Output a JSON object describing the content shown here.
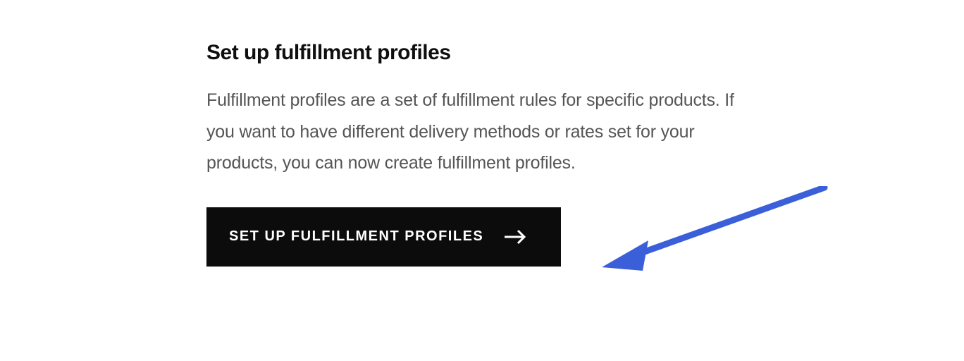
{
  "section": {
    "heading": "Set up fulfillment profiles",
    "description": "Fulfillment profiles are a set of fulfillment rules for specific products. If you want to have different delivery methods or rates set for your products, you can now create fulfillment profiles.",
    "button_label": "SET UP FULFILLMENT PROFILES"
  },
  "colors": {
    "button_bg": "#0c0c0c",
    "button_text": "#ffffff",
    "heading_text": "#0f0f0f",
    "body_text": "#555555",
    "annotation_arrow": "#3b5fd9"
  }
}
